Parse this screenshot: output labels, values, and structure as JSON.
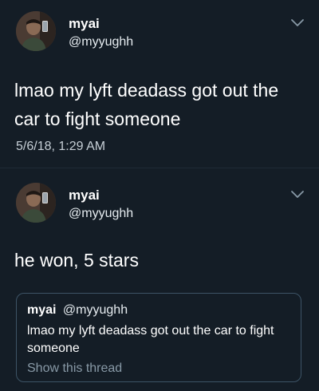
{
  "tweets": [
    {
      "name": "myai",
      "handle": "@myyughh",
      "text": "lmao my lyft deadass got out the car to fight someone",
      "timestamp": "5/6/18, 1:29 AM"
    },
    {
      "name": "myai",
      "handle": "@myyughh",
      "text": "he won, 5 stars",
      "quoted": {
        "name": "myai",
        "handle": "@myyughh",
        "text": "lmao my lyft deadass got out the car to fight someone",
        "link": "Show this thread"
      }
    }
  ],
  "colors": {
    "background": "#141d26",
    "text": "#ffffff",
    "secondary": "#8899a6",
    "border": "#3d5466"
  },
  "icons": {
    "menu": "chevron-down-icon",
    "avatar": "profile-photo"
  }
}
